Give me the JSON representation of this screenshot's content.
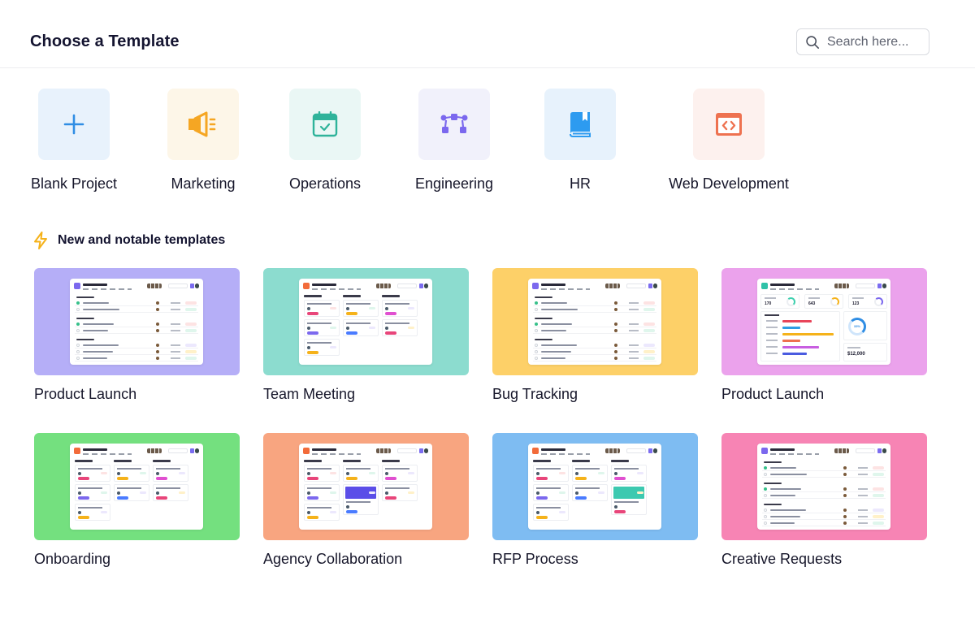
{
  "header": {
    "title": "Choose a Template",
    "search_placeholder": "Search here..."
  },
  "categories": [
    {
      "label": "Blank Project",
      "icon": "plus-icon",
      "tile_bg": "#e8f2fc",
      "icon_color": "#2f8de4"
    },
    {
      "label": "Marketing",
      "icon": "megaphone-icon",
      "tile_bg": "#fdf6e8",
      "icon_color": "#f5a623"
    },
    {
      "label": "Operations",
      "icon": "calendar-check-icon",
      "tile_bg": "#eaf7f5",
      "icon_color": "#2fb39a"
    },
    {
      "label": "Engineering",
      "icon": "workflow-icon",
      "tile_bg": "#f1f1fb",
      "icon_color": "#7b68ee"
    },
    {
      "label": "HR",
      "icon": "book-icon",
      "tile_bg": "#e7f2fc",
      "icon_color": "#2d9bf0"
    },
    {
      "label": "Web Development",
      "icon": "code-window-icon",
      "tile_bg": "#fdf1ee",
      "icon_color": "#ee7250"
    }
  ],
  "section": {
    "title": "New and notable templates",
    "icon": "lightning-icon",
    "icon_color": "#f5b21a"
  },
  "templates": [
    {
      "name": "Product Launch",
      "bg": "#b5aef7",
      "preview": "list",
      "logo_color": "#7b68ee"
    },
    {
      "name": "Team Meeting",
      "bg": "#8cdccf",
      "preview": "board",
      "logo_color": "#f26b3a"
    },
    {
      "name": "Bug Tracking",
      "bg": "#fdd068",
      "preview": "list",
      "logo_color": "#7b68ee"
    },
    {
      "name": "Product Launch",
      "bg": "#eba2ec",
      "preview": "dashboard",
      "logo_color": "#2fc2a8"
    },
    {
      "name": "Onboarding",
      "bg": "#74e07f",
      "preview": "board",
      "logo_color": "#f26b3a"
    },
    {
      "name": "Agency Collaboration",
      "bg": "#f8a580",
      "preview": "board-image",
      "logo_color": "#f26b3a"
    },
    {
      "name": "RFP Process",
      "bg": "#7ebcf2",
      "preview": "board-image2",
      "logo_color": "#f26b3a"
    },
    {
      "name": "Creative Requests",
      "bg": "#f784b4",
      "preview": "list",
      "logo_color": "#7b68ee"
    }
  ],
  "dashboard_preview": {
    "kpis": [
      "170",
      "643",
      "123"
    ],
    "donut_pct": "33%",
    "total": "$12,000"
  }
}
